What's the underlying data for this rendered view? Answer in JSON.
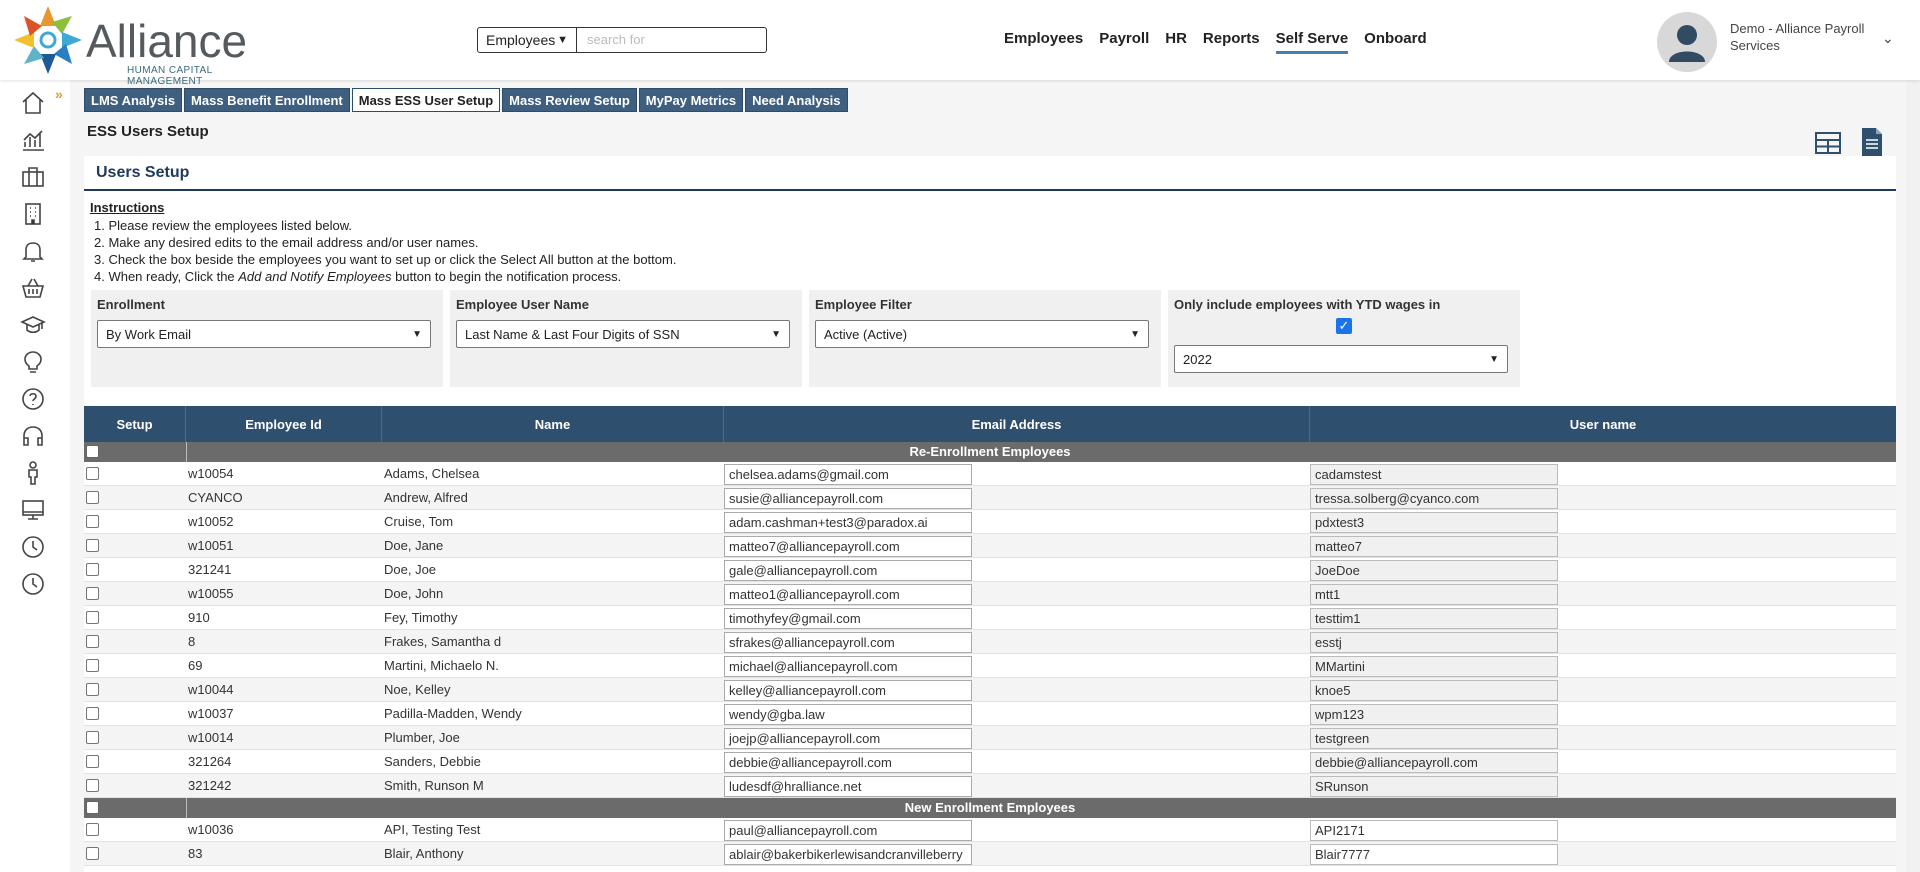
{
  "header": {
    "logo_text": "Alliance",
    "logo_sub": "HUMAN CAPITAL MANAGEMENT",
    "search": {
      "category": "Employees",
      "placeholder": "search for"
    },
    "nav": [
      "Employees",
      "Payroll",
      "HR",
      "Reports",
      "Self Serve",
      "Onboard"
    ],
    "active_nav": "Self Serve",
    "user_name": "Demo - Alliance Payroll Services"
  },
  "sidebar": {
    "icons": [
      "home-icon",
      "chart-icon",
      "briefcase-icon",
      "building-icon",
      "bell-icon",
      "basket-icon",
      "graduation-cap-icon",
      "lightbulb-icon",
      "help-icon",
      "headset-icon",
      "person-icon",
      "monitor-icon",
      "clock-icon",
      "clock-icon"
    ]
  },
  "subtabs": [
    "LMS Analysis",
    "Mass Benefit Enrollment",
    "Mass ESS User Setup",
    "Mass Review Setup",
    "MyPay Metrics",
    "Need Analysis"
  ],
  "active_subtab": "Mass ESS User Setup",
  "page_title": "ESS Users Setup",
  "panel": {
    "title": "Users Setup",
    "instructions_title": "Instructions",
    "instructions": [
      "1. Please review the employees listed below.",
      "2. Make any desired edits to the email address and/or user names.",
      "3. Check the box beside the employees you want to set up or click the Select All button at the bottom."
    ],
    "instruction4_pre": "4. When ready, Click the ",
    "instruction4_em": "Add and Notify Employees",
    "instruction4_post": " button to begin the notification process."
  },
  "filters": {
    "enrollment": {
      "label": "Enrollment",
      "value": "By Work Email"
    },
    "username": {
      "label": "Employee User Name",
      "value": "Last Name & Last Four Digits of SSN"
    },
    "employee_filter": {
      "label": "Employee Filter",
      "value": "Active (Active)"
    },
    "ytd": {
      "label": "Only include employees with YTD wages in",
      "checked": true,
      "year": "2022"
    }
  },
  "table": {
    "headers": [
      "Setup",
      "Employee Id",
      "Name",
      "Email Address",
      "User name"
    ],
    "group1": "Re-Enrollment Employees",
    "re_enrollment": [
      {
        "id": "w10054",
        "name": "Adams, Chelsea",
        "email": "chelsea.adams@gmail.com",
        "user": "cadamstest"
      },
      {
        "id": "CYANCO",
        "name": "Andrew, Alfred",
        "email": "susie@alliancepayroll.com",
        "user": "tressa.solberg@cyanco.com"
      },
      {
        "id": "w10052",
        "name": "Cruise, Tom",
        "email": "adam.cashman+test3@paradox.ai",
        "user": "pdxtest3"
      },
      {
        "id": "w10051",
        "name": "Doe, Jane",
        "email": "matteo7@alliancepayroll.com",
        "user": "matteo7"
      },
      {
        "id": "321241",
        "name": "Doe, Joe",
        "email": "gale@alliancepayroll.com",
        "user": "JoeDoe"
      },
      {
        "id": "w10055",
        "name": "Doe, John",
        "email": "matteo1@alliancepayroll.com",
        "user": "mtt1"
      },
      {
        "id": "910",
        "name": "Fey, Timothy",
        "email": "timothyfey@gmail.com",
        "user": "testtim1"
      },
      {
        "id": "8",
        "name": "Frakes, Samantha d",
        "email": "sfrakes@alliancepayroll.com",
        "user": "esstj"
      },
      {
        "id": "69",
        "name": "Martini, Michaelo N.",
        "email": "michael@alliancepayroll.com",
        "user": "MMartini"
      },
      {
        "id": "w10044",
        "name": "Noe, Kelley",
        "email": "kelley@alliancepayroll.com",
        "user": "knoe5"
      },
      {
        "id": "w10037",
        "name": "Padilla-Madden, Wendy",
        "email": "wendy@gba.law",
        "user": "wpm123"
      },
      {
        "id": "w10014",
        "name": "Plumber, Joe",
        "email": "joejp@alliancepayroll.com",
        "user": "testgreen"
      },
      {
        "id": "321264",
        "name": "Sanders, Debbie",
        "email": "debbie@alliancepayroll.com",
        "user": "debbie@alliancepayroll.com"
      },
      {
        "id": "321242",
        "name": "Smith, Runson M",
        "email": "ludesdf@hralliance.net",
        "user": "SRunson"
      }
    ],
    "group2": "New Enrollment Employees",
    "new_enrollment": [
      {
        "id": "w10036",
        "name": "API, Testing Test",
        "email": "paul@alliancepayroll.com",
        "user": "API2171"
      },
      {
        "id": "83",
        "name": "Blair, Anthony",
        "email": "ablair@bakerbikerlewisandcranvilleberry",
        "user": "Blair7777"
      }
    ]
  },
  "colors": {
    "nav_bar": "#2f4f6e",
    "tab": "#3e5f80",
    "accent": "#4a7ea8",
    "group_row": "#6b6b6b"
  }
}
